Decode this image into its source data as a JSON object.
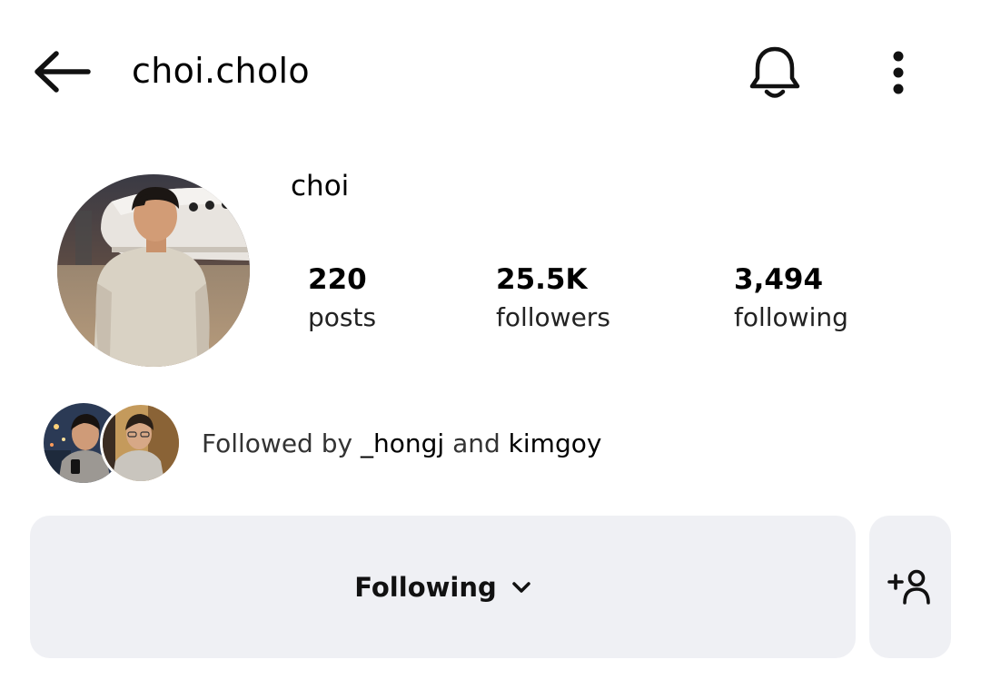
{
  "header": {
    "username": "choi.cholo",
    "back_icon": "arrow-left-icon",
    "notifications_icon": "bell-icon",
    "more_icon": "more-vertical-icon"
  },
  "profile": {
    "display_name": "choi",
    "avatar_icon": "profile-photo"
  },
  "stats": [
    {
      "value": "220",
      "label": "posts"
    },
    {
      "value": "25.5K",
      "label": "followers"
    },
    {
      "value": "3,494",
      "label": "following"
    }
  ],
  "followed_by": {
    "prefix": "Followed by",
    "user1": "_hongj",
    "conjunction": "and",
    "user2": "kimgoy"
  },
  "actions": {
    "following_label": "Following",
    "following_icon": "chevron-down-icon",
    "add_user_icon": "add-person-icon"
  },
  "colors": {
    "button_background": "#eff0f4",
    "text": "#000000"
  }
}
